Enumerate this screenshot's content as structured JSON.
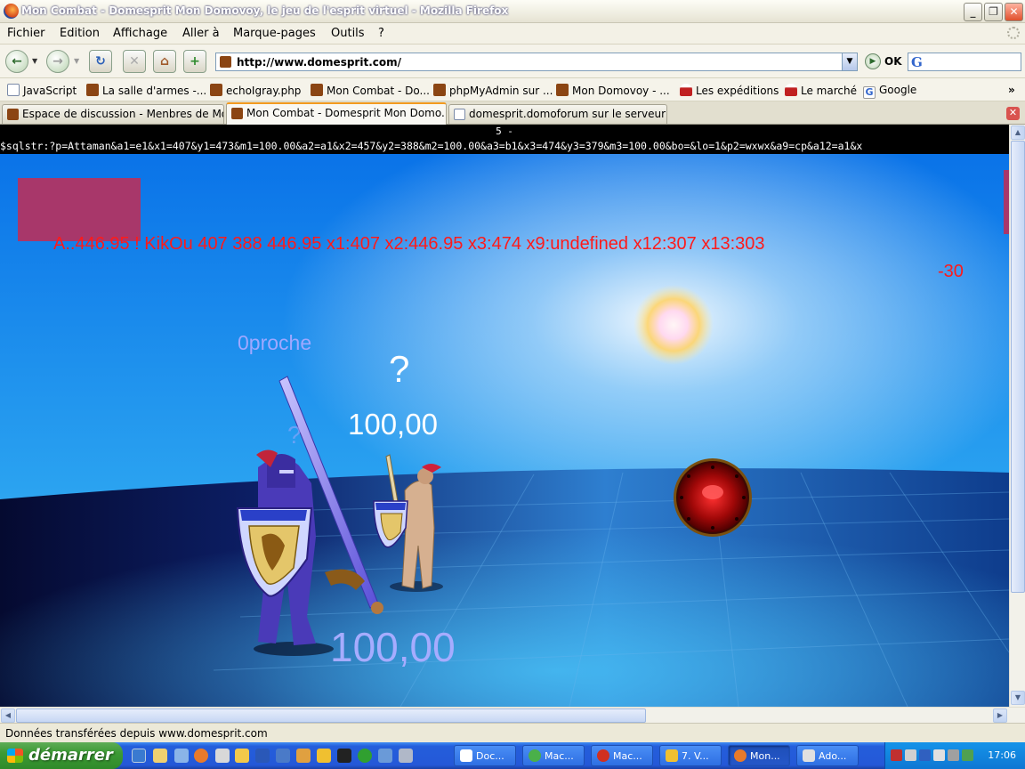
{
  "window": {
    "title": "Mon Combat - Domesprit Mon Domovoy, le jeu de l'esprit virtuel - Mozilla Firefox",
    "minimize_label": "_",
    "maximize_label": "❐",
    "close_label": "✕"
  },
  "menu": [
    "Fichier",
    "Edition",
    "Affichage",
    "Aller à",
    "Marque-pages",
    "Outils",
    "?"
  ],
  "nav": {
    "url": "http://www.domesprit.com/",
    "go_label": "OK",
    "search_value": "",
    "search_engine_glyph": "G",
    "back_glyph": "←",
    "forward_glyph": "→",
    "reload_glyph": "↻",
    "stop_glyph": "✕",
    "home_glyph": "⌂",
    "new_glyph": "+"
  },
  "bookmarks": [
    {
      "label": "JavaScript",
      "icon": "page"
    },
    {
      "label": "La salle d'armes -...",
      "icon": "home"
    },
    {
      "label": "echoIgray.php",
      "icon": "home"
    },
    {
      "label": "Mon Combat - Do...",
      "icon": "home"
    },
    {
      "label": "phpMyAdmin sur ...",
      "icon": "home"
    },
    {
      "label": "Mon Domovoy - ...",
      "icon": "home"
    },
    {
      "label": "Les expéditions",
      "icon": "red"
    },
    {
      "label": "Le marché",
      "icon": "red"
    },
    {
      "label": "Google",
      "icon": "google"
    }
  ],
  "bookmarks_more": "»",
  "tabs": [
    {
      "label": "Espace de discussion - Menbres de Mo...",
      "active": false
    },
    {
      "label": "Mon Combat - Domesprit Mon Domo...",
      "active": true
    },
    {
      "label": "domesprit.domoforum sur le serveur l...",
      "active": false
    }
  ],
  "tab_close": "✕",
  "page": {
    "line1": "5 -",
    "line2": "$sqlstr:?p=Attaman&a1=e1&x1=407&y1=473&m1=100.00&a2=a1&x2=457&y2=388&m2=100.00&a3=b1&x3=474&y3=379&m3=100.00&bo=&lo=1&p2=wxwx&a9=cp&a12=a1&x",
    "debug_line": "A..446.95 !  KikOu   407 388  446.95 x1:407 x2:446.95 x3:474 x9:undefined x12:307 x13:303",
    "damage": "-30",
    "near_label": "0proche",
    "question_mark": "?",
    "question_mark_small": "?",
    "value_enemy": "100,00",
    "value_player": "100,00"
  },
  "status": "Données transférées depuis www.domesprit.com",
  "taskbar": {
    "start_label": "démarrer",
    "tasks": [
      {
        "label": "Doc...",
        "active": false
      },
      {
        "label": "Mac...",
        "active": false
      },
      {
        "label": "Mac...",
        "active": false
      },
      {
        "label": "7. V...",
        "active": false
      },
      {
        "label": "Mon...",
        "active": true
      },
      {
        "label": "Ado...",
        "active": false
      }
    ],
    "clock": "17:06"
  },
  "colors": {
    "debug_text": "#ff1a1a",
    "near_label": "#9fa8ff",
    "white_text": "#ffffff",
    "player_value": "#a6acff"
  }
}
